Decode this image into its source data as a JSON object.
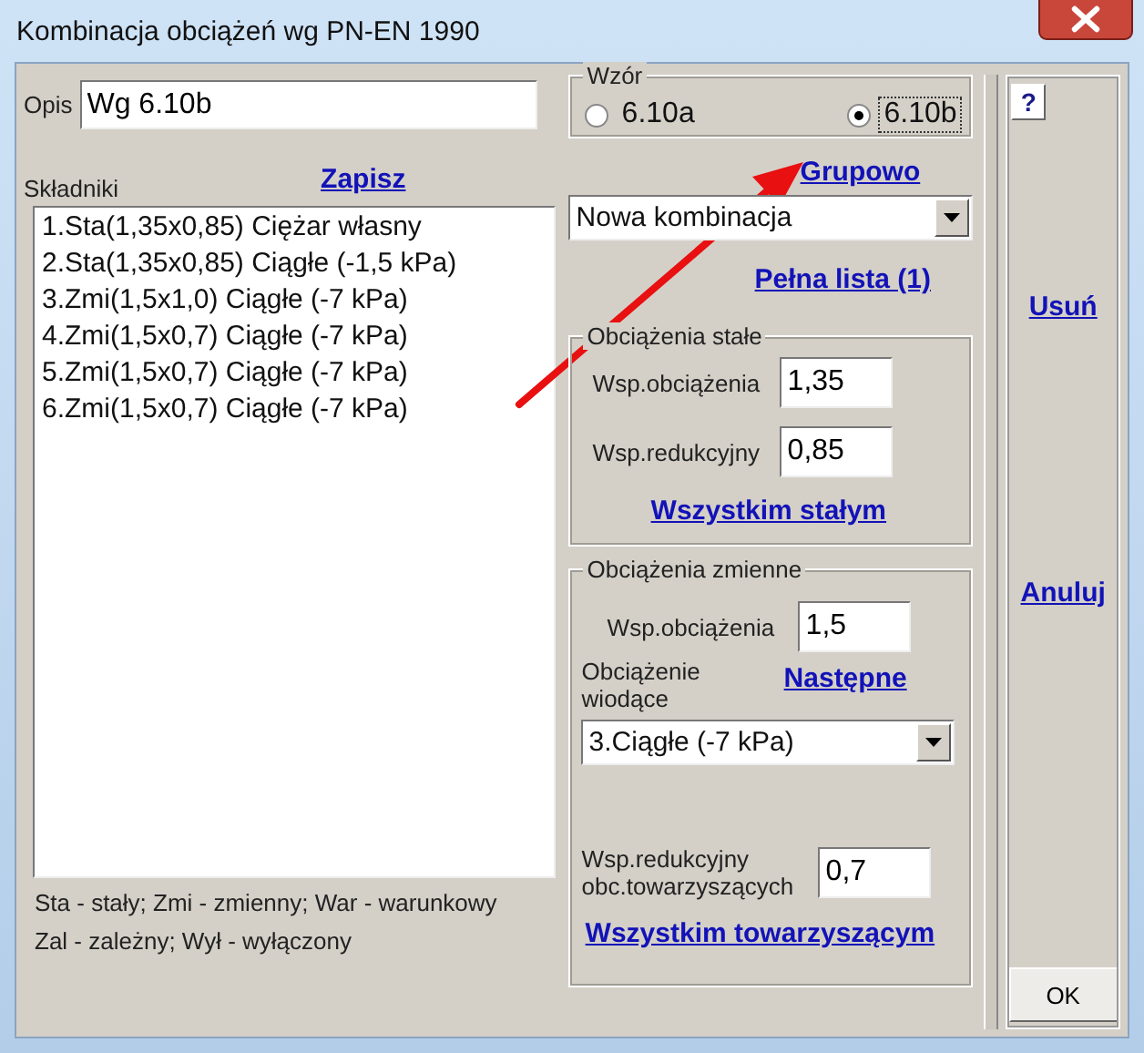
{
  "window": {
    "title": "Kombinacja obciążeń wg PN-EN 1990"
  },
  "description": {
    "label": "Opis",
    "value": "Wg 6.10b"
  },
  "formula": {
    "label": "Wzór",
    "options": [
      {
        "label": "6.10a",
        "selected": false
      },
      {
        "label": "6.10b",
        "selected": true
      }
    ]
  },
  "components": {
    "label": "Składniki",
    "save_link": "Zapisz",
    "items": [
      "1.Sta(1,35x0,85) Ciężar własny",
      "2.Sta(1,35x0,85) Ciągłe (-1,5 kPa)",
      "3.Zmi(1,5x1,0) Ciągłe (-7 kPa)",
      "4.Zmi(1,5x0,7) Ciągłe (-7 kPa)",
      "5.Zmi(1,5x0,7) Ciągłe (-7 kPa)",
      "6.Zmi(1,5x0,7) Ciągłe (-7 kPa)"
    ]
  },
  "group_link": "Grupowo",
  "combination_select": {
    "value": "Nowa kombinacja"
  },
  "full_list_link": "Pełna lista (1)",
  "permanent": {
    "title": "Obciążenia stałe",
    "load_factor": {
      "label": "Wsp.obciążenia",
      "value": "1,35"
    },
    "reduction_factor": {
      "label": "Wsp.redukcyjny",
      "value": "0,85"
    },
    "apply_link": "Wszystkim stałym"
  },
  "variable": {
    "title": "Obciążenia zmienne",
    "load_factor": {
      "label": "Wsp.obciążenia",
      "value": "1,5"
    },
    "leading": {
      "label": "Obciążenie wiodące",
      "link": "Następne",
      "value": "3.Ciągłe (-7 kPa)"
    },
    "reduction_factor": {
      "label": "Wsp.redukcyjny obc.towarzyszących",
      "value": "0,7"
    },
    "apply_link": "Wszystkim towarzyszącym"
  },
  "legend": [
    "Sta - stały; Zmi - zmienny; War - warunkowy",
    "Zal - zależny; Wył - wyłączony"
  ],
  "side": {
    "help": "?",
    "delete_link": "Usuń",
    "cancel_link": "Anuluj",
    "ok": "OK"
  }
}
